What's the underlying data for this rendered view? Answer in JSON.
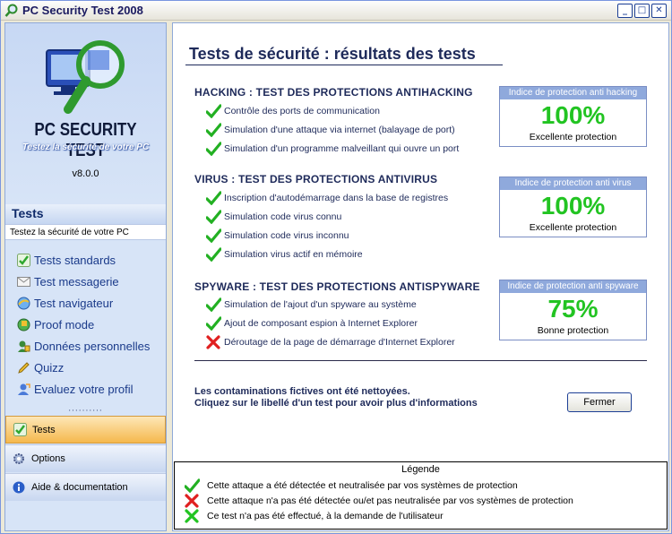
{
  "window": {
    "title": "PC Security Test 2008"
  },
  "sidebar": {
    "logo_title": "PC SECURITY TEST",
    "logo_subtitle": "Testez la sécurité de votre PC",
    "version": "v8.0.0",
    "section_header": "Tests",
    "section_subtitle": "Testez la sécurité de votre PC",
    "items": [
      {
        "label": "Tests standards",
        "icon": "check-icon"
      },
      {
        "label": "Test messagerie",
        "icon": "mail-icon"
      },
      {
        "label": "Test navigateur",
        "icon": "browser-icon"
      },
      {
        "label": "Proof mode",
        "icon": "proof-icon"
      },
      {
        "label": "Données personnelles",
        "icon": "personal-data-icon"
      },
      {
        "label": "Quizz",
        "icon": "pencil-icon"
      },
      {
        "label": "Evaluez votre profil",
        "icon": "profile-icon"
      }
    ],
    "dots": "··········",
    "bottom_tabs": [
      {
        "label": "Tests",
        "icon": "check-icon",
        "active": true
      },
      {
        "label": "Options",
        "icon": "gear-icon",
        "active": false
      },
      {
        "label": "Aide & documentation",
        "icon": "info-icon",
        "active": false
      }
    ]
  },
  "main": {
    "title": "Tests de sécurité : résultats des tests",
    "sections": [
      {
        "title": "HACKING : TEST DES PROTECTIONS ANTIHACKING",
        "tests": [
          {
            "label": "Contrôle des ports de communication",
            "status": "passed"
          },
          {
            "label": "Simulation d'une attaque via internet (balayage de port)",
            "status": "passed"
          },
          {
            "label": "Simulation d'un programme malveillant qui ouvre un port",
            "status": "passed"
          }
        ],
        "score": {
          "header": "Indice de protection anti hacking",
          "value": "100%",
          "label": "Excellente protection",
          "color": "#22C422"
        }
      },
      {
        "title": "VIRUS : TEST DES PROTECTIONS ANTIVIRUS",
        "tests": [
          {
            "label": "Inscription d'autodémarrage dans la base de registres",
            "status": "passed"
          },
          {
            "label": "Simulation code virus connu",
            "status": "passed"
          },
          {
            "label": "Simulation code virus inconnu",
            "status": "passed"
          },
          {
            "label": "Simulation virus actif en mémoire",
            "status": "passed"
          }
        ],
        "score": {
          "header": "Indice de protection anti virus",
          "value": "100%",
          "label": "Excellente protection",
          "color": "#22C422"
        }
      },
      {
        "title": "SPYWARE : TEST DES PROTECTIONS ANTISPYWARE",
        "tests": [
          {
            "label": "Simulation de l'ajout d'un spyware au système",
            "status": "passed"
          },
          {
            "label": "Ajout de composant espion à Internet Explorer",
            "status": "passed"
          },
          {
            "label": "Déroutage de la page de démarrage d'Internet Explorer",
            "status": "failed"
          }
        ],
        "score": {
          "header": "Indice de protection anti spyware",
          "value": "75%",
          "label": "Bonne protection",
          "color": "#22C422"
        }
      }
    ],
    "info_line1": "Les contaminations fictives ont été nettoyées.",
    "info_line2": "Cliquez sur le libellé d'un test pour avoir plus d'informations",
    "close_button": "Fermer",
    "legend": {
      "title": "Légende",
      "items": [
        {
          "icon": "green-check-icon",
          "text": "Cette attaque a été détectée et neutralisée par vos systèmes de protection"
        },
        {
          "icon": "red-cross-icon",
          "text": "Cette attaque n'a pas été détectée ou/et pas neutralisée par vos systèmes de protection"
        },
        {
          "icon": "green-cross-icon",
          "text": "Ce test n'a pas été effectué, à la demande de l'utilisateur"
        }
      ]
    }
  }
}
